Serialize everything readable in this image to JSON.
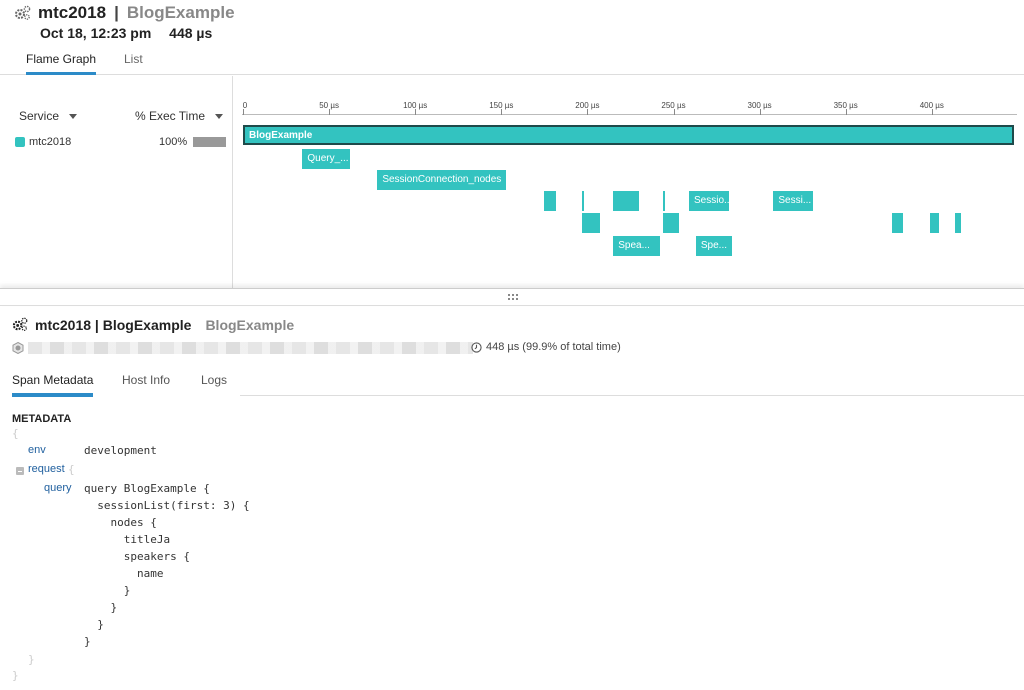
{
  "header": {
    "service": "mtc2018",
    "separator": "|",
    "resource": "BlogExample",
    "date": "Oct 18, 12:23 pm",
    "duration": "448 µs"
  },
  "top_tabs": [
    {
      "label": "Flame Graph",
      "active": true
    },
    {
      "label": "List",
      "active": false
    }
  ],
  "service_table": {
    "col_service": "Service",
    "col_exec": "% Exec Time",
    "rows": [
      {
        "name": "mtc2018",
        "pct": "100%",
        "color": "#33c3c0",
        "fraction": 1.0
      }
    ]
  },
  "flame_graph": {
    "axis_unit": "µs",
    "ticks": [
      "0",
      "50 µs",
      "100 µs",
      "150 µs",
      "200 µs",
      "250 µs",
      "300 µs",
      "350 µs",
      "400 µs"
    ],
    "tick_values": [
      0,
      50,
      100,
      150,
      200,
      250,
      300,
      350,
      400
    ],
    "total_us": 448,
    "color": "#33c3c0",
    "spans": [
      {
        "label": "BlogExample",
        "start": 0,
        "end": 448,
        "depth": 0,
        "root": true
      },
      {
        "label": "Query_...",
        "start": 34.5,
        "end": 62,
        "depth": 1
      },
      {
        "label": "SessionConnection_nodes",
        "start": 78,
        "end": 153,
        "depth": 2
      },
      {
        "label": "",
        "start": 175,
        "end": 182,
        "depth": 3
      },
      {
        "label": "",
        "start": 197,
        "end": 198,
        "depth": 3
      },
      {
        "label": "",
        "start": 197,
        "end": 207.5,
        "depth": 4
      },
      {
        "label": "",
        "start": 215,
        "end": 230,
        "depth": 3
      },
      {
        "label": "Spea...",
        "start": 215,
        "end": 242,
        "depth": 5
      },
      {
        "label": "",
        "start": 244,
        "end": 245,
        "depth": 3
      },
      {
        "label": "",
        "start": 244,
        "end": 253,
        "depth": 4
      },
      {
        "label": "Sessio...",
        "start": 259,
        "end": 282,
        "depth": 3
      },
      {
        "label": "Spe...",
        "start": 263,
        "end": 284,
        "depth": 5
      },
      {
        "label": "Sessi...",
        "start": 308,
        "end": 331,
        "depth": 3
      },
      {
        "label": "",
        "start": 377,
        "end": 383,
        "depth": 4
      },
      {
        "label": "",
        "start": 399,
        "end": 404,
        "depth": 4
      },
      {
        "label": "",
        "start": 413.5,
        "end": 417,
        "depth": 4
      }
    ]
  },
  "detail": {
    "title": "mtc2018 | BlogExample",
    "subtitle": "BlogExample",
    "duration_text": "448 µs (99.9% of total time)",
    "tabs": [
      {
        "label": "Span Metadata",
        "active": true
      },
      {
        "label": "Host Info",
        "active": false
      },
      {
        "label": "Logs",
        "active": false
      }
    ],
    "metadata_heading": "METADATA",
    "open_brace": "{",
    "close_brace": "}",
    "env_key": "env",
    "env_value": "development",
    "request_key": "request",
    "query_key": "query",
    "query_lines": [
      "query BlogExample {",
      "  sessionList(first: 3) {",
      "    nodes {",
      "      titleJa",
      "      speakers {",
      "        name",
      "      }",
      "    }",
      "  }",
      "}"
    ]
  }
}
